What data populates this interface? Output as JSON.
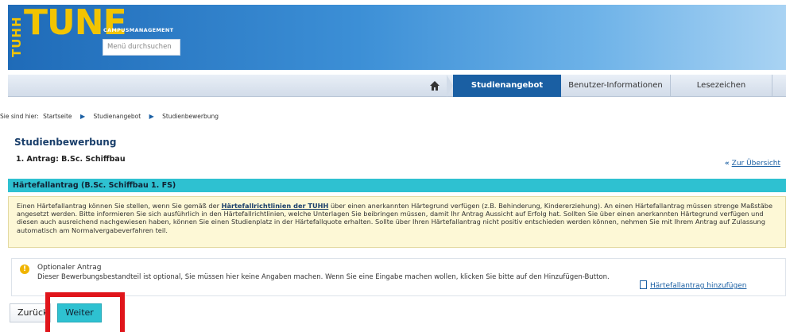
{
  "header": {
    "logo_vertical": "TUHH",
    "logo_main": "TUNE",
    "logo_sub": "CAMPUSMANAGEMENT",
    "search_placeholder": "Menü durchsuchen"
  },
  "nav": {
    "home_icon": "home-icon",
    "items": [
      {
        "label": "Studienangebot",
        "active": true
      },
      {
        "label": "Benutzer-Informationen",
        "active": false
      },
      {
        "label": "Lesezeichen",
        "active": false
      }
    ]
  },
  "breadcrumb": {
    "prefix": "Sie sind hier:",
    "items": [
      "Startseite",
      "Studienangebot",
      "Studienbewerbung"
    ]
  },
  "page": {
    "title": "Studienbewerbung",
    "subtitle": "1. Antrag: B.Sc. Schiffbau",
    "overview_link": "Zur Übersicht"
  },
  "section": {
    "header": "Härtefallantrag (B.Sc. Schiffbau 1. FS)",
    "info_part1": "Einen Härtefallantrag können Sie stellen, wenn Sie gemäß der ",
    "info_link": "Härtefallrichtlinien der TUHH",
    "info_part2": " über einen anerkannten Härtegrund verfügen (z.B. Behinderung, Kindererziehung). An einen Härtefallantrag müssen strenge Maßstäbe angesetzt werden. Bitte informieren Sie sich ausführlich in den Härtefallrichtlinien, welche Unterlagen Sie beibringen müssen, damit Ihr Antrag Aussicht auf Erfolg hat. Sollten Sie über einen anerkannten Härtegrund verfügen und diesen auch ausreichend nachgewiesen haben, können Sie einen Studienplatz in der Härtefallquote erhalten. Sollte über Ihren Härtefallantrag nicht positiv entschieden werden können, nehmen Sie mit Ihrem Antrag auf Zulassung automatisch am Normalvergabeverfahren teil."
  },
  "optional": {
    "title": "Optionaler Antrag",
    "text": "Dieser Bewerbungsbestandteil ist optional, Sie müssen hier keine Angaben machen. Wenn Sie eine Eingabe machen wollen, klicken Sie bitte auf den Hinzufügen-Button.",
    "add_link": "Härtefallantrag hinzufügen"
  },
  "buttons": {
    "back": "Zurück",
    "next": "Weiter"
  },
  "colors": {
    "accent_teal": "#2ec1d1",
    "nav_active": "#1a5fa3",
    "highlight_red": "#e0151b",
    "logo_yellow": "#f2c400"
  }
}
